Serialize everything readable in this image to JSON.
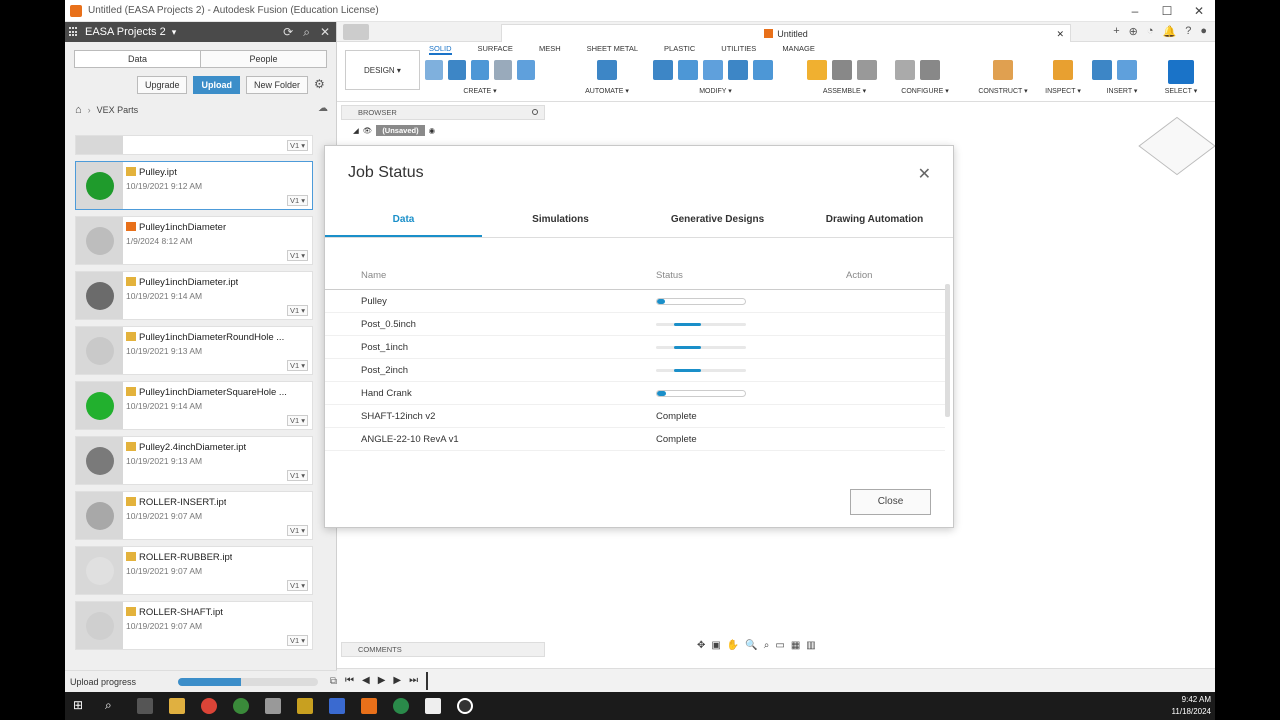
{
  "window": {
    "title": "Untitled (EASA Projects 2) - Autodesk Fusion (Education License)"
  },
  "data_panel": {
    "project": "EASA Projects 2",
    "tabs": [
      "Data",
      "People"
    ],
    "actions": {
      "upgrade": "Upgrade",
      "upload": "Upload",
      "new_folder": "New Folder"
    },
    "breadcrumb": "VEX Parts",
    "files": [
      {
        "name": "Pulley.ipt",
        "date": "10/19/2021 9:12 AM",
        "version": "V1",
        "thumb_color": "#1f9b2c",
        "icon": "ipt-file-icon"
      },
      {
        "name": "Pulley1inchDiameter",
        "date": "1/9/2024 8:12 AM",
        "version": "V1",
        "thumb_color": "#bdbdbd",
        "icon": "design-file-icon"
      },
      {
        "name": "Pulley1inchDiameter.ipt",
        "date": "10/19/2021 9:14 AM",
        "version": "V1",
        "thumb_color": "#6b6b6b",
        "icon": "ipt-file-icon"
      },
      {
        "name": "Pulley1inchDiameterRoundHole ...",
        "date": "10/19/2021 9:13 AM",
        "version": "V1",
        "thumb_color": "#c9c9c9",
        "icon": "ipt-file-icon"
      },
      {
        "name": "Pulley1inchDiameterSquareHole ...",
        "date": "10/19/2021 9:14 AM",
        "version": "V1",
        "thumb_color": "#22b02e",
        "icon": "ipt-file-icon"
      },
      {
        "name": "Pulley2.4inchDiameter.ipt",
        "date": "10/19/2021 9:13 AM",
        "version": "V1",
        "thumb_color": "#7a7a7a",
        "icon": "ipt-file-icon"
      },
      {
        "name": "ROLLER-INSERT.ipt",
        "date": "10/19/2021 9:07 AM",
        "version": "V1",
        "thumb_color": "#a8a8a8",
        "icon": "ipt-file-icon"
      },
      {
        "name": "ROLLER-RUBBER.ipt",
        "date": "10/19/2021 9:07 AM",
        "version": "V1",
        "thumb_color": "#e0e0e0",
        "icon": "ipt-file-icon"
      },
      {
        "name": "ROLLER-SHAFT.ipt",
        "date": "10/19/2021 9:07 AM",
        "version": "V1",
        "thumb_color": "#cfcfcf",
        "icon": "ipt-file-icon"
      }
    ],
    "upload_progress": {
      "label": "Upload progress",
      "fraction": 0.45
    }
  },
  "tabbar": {
    "doc_title": "Untitled"
  },
  "toolbar": {
    "design_label": "DESIGN ▾",
    "workspace_tabs": [
      "SOLID",
      "SURFACE",
      "MESH",
      "SHEET METAL",
      "PLASTIC",
      "UTILITIES",
      "MANAGE"
    ],
    "groups": [
      "CREATE ▾",
      "AUTOMATE ▾",
      "MODIFY ▾",
      "ASSEMBLE ▾",
      "CONFIGURE ▾",
      "CONSTRUCT ▾",
      "INSPECT ▾",
      "INSERT ▾",
      "SELECT ▾"
    ]
  },
  "canvas": {
    "browser_label": "BROWSER",
    "unsaved_label": "(Unsaved)",
    "comments_label": "COMMENTS"
  },
  "dialog": {
    "title": "Job Status",
    "tabs": [
      "Data",
      "Simulations",
      "Generative Designs",
      "Drawing Automation"
    ],
    "columns": {
      "name": "Name",
      "status": "Status",
      "action": "Action"
    },
    "rows": [
      {
        "name": "Pulley",
        "status_text": "",
        "progress": 0.0,
        "style": "bar"
      },
      {
        "name": "Post_0.5inch",
        "status_text": "",
        "progress": 0.55,
        "style": "stripe"
      },
      {
        "name": "Post_1inch",
        "status_text": "",
        "progress": 0.55,
        "style": "stripe"
      },
      {
        "name": "Post_2inch",
        "status_text": "",
        "progress": 0.55,
        "style": "stripe"
      },
      {
        "name": "Hand Crank",
        "status_text": "",
        "progress": 0.1,
        "style": "bar"
      },
      {
        "name": "SHAFT-12inch v2",
        "status_text": "Complete",
        "progress": null,
        "style": "text"
      },
      {
        "name": "ANGLE-22-10 RevA v1",
        "status_text": "Complete",
        "progress": null,
        "style": "text"
      }
    ],
    "close_label": "Close"
  },
  "taskbar": {
    "time": "9:42 AM",
    "date": "11/18/2024"
  }
}
